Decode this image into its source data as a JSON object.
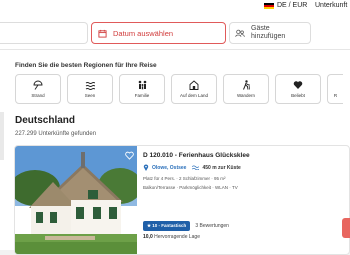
{
  "header": {
    "language_currency": "DE / EUR",
    "accommodation_link": "Unterkunft"
  },
  "search": {
    "date_placeholder": "Datum auswählen",
    "guests_placeholder": "Gäste hinzufügen"
  },
  "regions": {
    "title": "Finden Sie die besten Regionen für Ihre Reise",
    "items": [
      {
        "label": "Strand",
        "icon": "umbrella-icon"
      },
      {
        "label": "Seen",
        "icon": "lake-icon"
      },
      {
        "label": "Familie",
        "icon": "family-icon"
      },
      {
        "label": "Auf dem Land",
        "icon": "barn-icon"
      },
      {
        "label": "Wandern",
        "icon": "hiker-icon"
      },
      {
        "label": "Beliebt",
        "icon": "heart-icon"
      },
      {
        "label": "R",
        "icon": "cut-icon"
      }
    ]
  },
  "results": {
    "heading": "Deutschland",
    "count_text": "227.299 Unterkünfte gefunden"
  },
  "listing": {
    "title": "D 120.010 - Ferienhaus Glücksklee",
    "location": "Olowe, Ostsee",
    "distance": "450 m zur Küste",
    "facts_line1": "Platz für 4 Pers.  ·  2 Schlafzimmer  ·  95 m²",
    "facts_line2": "Balkon/Terrasse  ·  Parkmöglichkeit  ·  WLAN  ·  TV",
    "rating_badge": "10 - Fantastisch",
    "reviews": "3 Bewertungen",
    "summary_score": "10,0",
    "summary_text": "Hervorragende Lage"
  },
  "colors": {
    "accent_red": "#d03b3b",
    "badge_blue": "#1f5fa8",
    "link_blue": "#2a6fba"
  }
}
